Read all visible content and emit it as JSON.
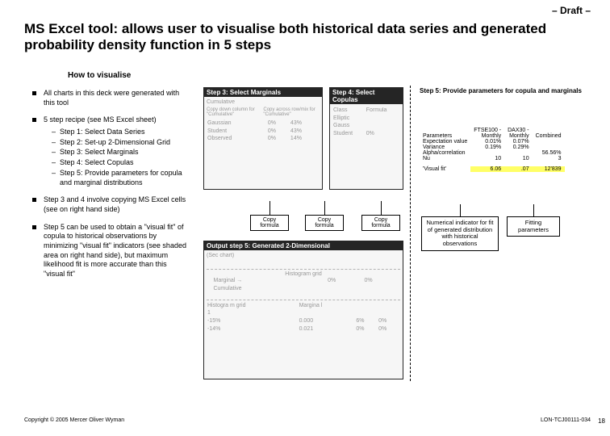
{
  "draft_label": "– Draft –",
  "title": "MS Excel tool: allows user to visualise both historical data series and generated probability density function in 5 steps",
  "subheading": "How to visualise",
  "bullets": {
    "b1": "All charts in this deck were generated with this tool",
    "b2": "5 step recipe (see MS Excel sheet)",
    "b2s": {
      "s1": "Step 1: Select Data Series",
      "s2": "Step 2: Set-up 2-Dimensional Grid",
      "s3": "Step 3: Select Marginals",
      "s4": "Step 4: Select Copulas",
      "s5": "Step 5: Provide parameters for copula and marginal distributions"
    },
    "b3": "Step 3 and 4 involve copying MS Excel cells (see on right hand side)",
    "b4": "Step 5 can be used to obtain a \"visual fit\" of copula to historical observations by minimizing \"visual fit\" indicators (see shaded area on right hand side), but maximum likelihood fit is more accurate than this \"visual fit\""
  },
  "panes": {
    "p3": {
      "header": "Step 3: Select Marginals",
      "hint1": "Copy down column for \"Cumulative\"",
      "hint2": "Copy across row/mix for \"Cumulative\"",
      "col_cum": "Cumulative",
      "r1": "Gaussian",
      "v1a": "0%",
      "v1b": "43%",
      "r2": "Student",
      "v2a": "0%",
      "v2b": "43%",
      "r3": "Observed",
      "v3a": "0%",
      "v3b": "14%"
    },
    "p4": {
      "header": "Step 4: Select Copulas",
      "col_class": "Class",
      "col_formula": "Formula",
      "r1": "Elliptic",
      "r2": "Gauss",
      "r3": "Student",
      "v3": "0%"
    },
    "p5": {
      "header": "Output step 5: Generated 2-Dimensional",
      "sec": "(Sec chart)",
      "hg": "Histogram grid",
      "marg": "Marginal →",
      "cum": "Cumulative",
      "hg_row": "Histogra m grid",
      "mg_row": "Margina l",
      "r1a": "1",
      "r1b": "0%",
      "r1c": "0%",
      "r2a": "-15%",
      "r2b": "0.000",
      "r2c": "6%",
      "r2d": "0%",
      "r3a": "-14%",
      "r3b": "0.021",
      "r3c": "0%",
      "r3d": "0%"
    }
  },
  "copy_label": "Copy formula",
  "right": {
    "title": "Step 5: Provide parameters for copula and marginals",
    "headers": {
      "param": "Parameters",
      "c1a": "FTSE100 -",
      "c1b": "Monthly",
      "c2a": "DAX30 -",
      "c2b": "Monthly",
      "c3": "Combined"
    },
    "rows": {
      "r1": "Expectation value",
      "r1v1": "0.01%",
      "r1v2": "0.07%",
      "r2": "Variance",
      "r2v1": "0.19%",
      "r2v2": "0.29%",
      "r3": "Alpha/correlation",
      "r3v3": "56.56%",
      "r4": "Nu",
      "r4v1": "10",
      "r4v2": "10",
      "r4v3": "3",
      "r5": "'Visual fit'",
      "r5v1": "6.06",
      "r5v2": ".07",
      "r5v3": "12'839"
    }
  },
  "callouts": {
    "num": "Numerical indicator for fit of generated distribution with historical observations",
    "fit": "Fitting parameters"
  },
  "footer": {
    "left": "Copyright © 2005 Mercer Oliver Wyman",
    "right": "LON-TCJ00111-034",
    "page": "18"
  }
}
